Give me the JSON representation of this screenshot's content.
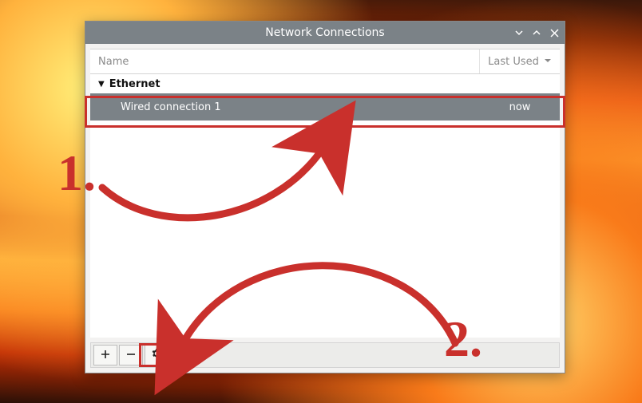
{
  "window": {
    "title": "Network Connections"
  },
  "columns": {
    "name": "Name",
    "last_used": "Last Used"
  },
  "group": {
    "label": "Ethernet"
  },
  "connection": {
    "name": "Wired connection 1",
    "last_used": "now"
  },
  "annotations": {
    "step1": "1.",
    "step2": "2."
  },
  "colors": {
    "titlebar": "#7b8287",
    "selected_row": "#7b8287",
    "annotation": "#c9302c"
  }
}
